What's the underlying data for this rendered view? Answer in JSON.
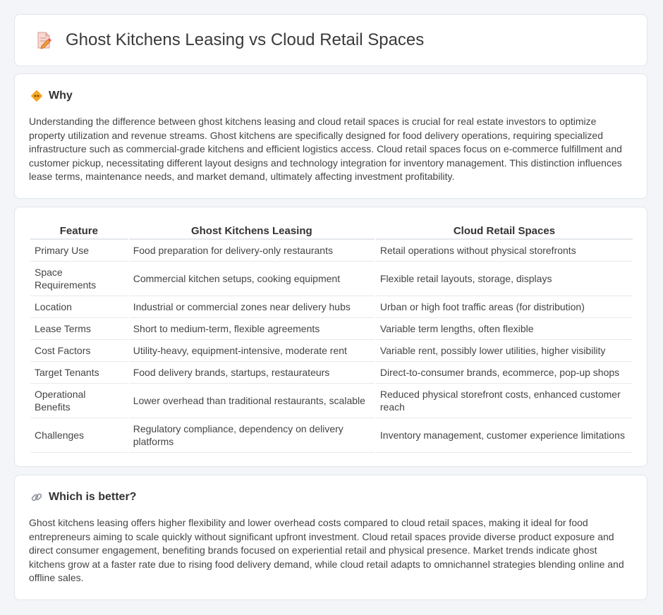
{
  "header": {
    "title": "Ghost Kitchens Leasing vs Cloud Retail Spaces",
    "icon": "pencil-document-icon"
  },
  "why": {
    "heading": "Why",
    "icon": "diamond-sign-icon",
    "body": "Understanding the difference between ghost kitchens leasing and cloud retail spaces is crucial for real estate investors to optimize property utilization and revenue streams. Ghost kitchens are specifically designed for food delivery operations, requiring specialized infrastructure such as commercial-grade kitchens and efficient logistics access. Cloud retail spaces focus on e-commerce fulfillment and customer pickup, necessitating different layout designs and technology integration for inventory management. This distinction influences lease terms, maintenance needs, and market demand, ultimately affecting investment profitability."
  },
  "table": {
    "headers": [
      "Feature",
      "Ghost Kitchens Leasing",
      "Cloud Retail Spaces"
    ],
    "rows": [
      [
        "Primary Use",
        "Food preparation for delivery-only restaurants",
        "Retail operations without physical storefronts"
      ],
      [
        "Space Requirements",
        "Commercial kitchen setups, cooking equipment",
        "Flexible retail layouts, storage, displays"
      ],
      [
        "Location",
        "Industrial or commercial zones near delivery hubs",
        "Urban or high foot traffic areas (for distribution)"
      ],
      [
        "Lease Terms",
        "Short to medium-term, flexible agreements",
        "Variable term lengths, often flexible"
      ],
      [
        "Cost Factors",
        "Utility-heavy, equipment-intensive, moderate rent",
        "Variable rent, possibly lower utilities, higher visibility"
      ],
      [
        "Target Tenants",
        "Food delivery brands, startups, restaurateurs",
        "Direct-to-consumer brands, ecommerce, pop-up shops"
      ],
      [
        "Operational Benefits",
        "Lower overhead than traditional restaurants, scalable",
        "Reduced physical storefront costs, enhanced customer reach"
      ],
      [
        "Challenges",
        "Regulatory compliance, dependency on delivery platforms",
        "Inventory management, customer experience limitations"
      ]
    ]
  },
  "which": {
    "heading": "Which is better?",
    "icon": "link-icon",
    "body": "Ghost kitchens leasing offers higher flexibility and lower overhead costs compared to cloud retail spaces, making it ideal for food entrepreneurs aiming to scale quickly without significant upfront investment. Cloud retail spaces provide diverse product exposure and direct consumer engagement, benefiting brands focused on experiential retail and physical presence. Market trends indicate ghost kitchens grow at a faster rate due to rising food delivery demand, while cloud retail adapts to omnichannel strategies blending online and offline sales."
  }
}
